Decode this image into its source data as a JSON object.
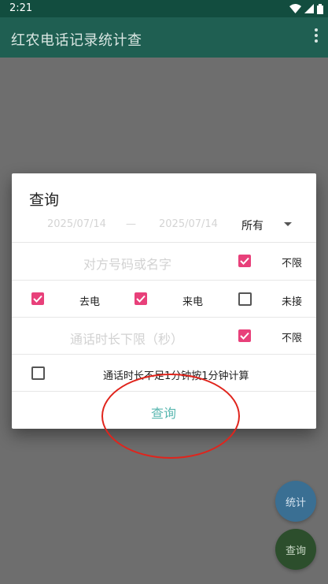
{
  "status": {
    "time": "2:21"
  },
  "appbar": {
    "title": "红农电话记录统计查"
  },
  "dialog": {
    "title": "查询",
    "date_from": "2025/07/14",
    "date_sep": "—",
    "date_to": "2025/07/14",
    "type_select": "所有",
    "number_placeholder": "对方号码或名字",
    "number_unlimited_label": "不限",
    "outgoing_label": "去电",
    "incoming_label": "来电",
    "missed_label": "未接",
    "duration_placeholder": "通话时长下限（秒）",
    "duration_unlimited_label": "不限",
    "round_label": "通话时长不足1分钟按1分钟计算",
    "query_button": "查询"
  },
  "fabs": {
    "stats": "统计",
    "query": "查询"
  },
  "checkbox_states": {
    "number_unlimited": true,
    "outgoing": true,
    "incoming": true,
    "missed": false,
    "duration_unlimited": true,
    "round_up": false
  },
  "colors": {
    "accent": "#e8407a",
    "appbar": "#1f5f52",
    "button_text": "#5ab7b0"
  }
}
